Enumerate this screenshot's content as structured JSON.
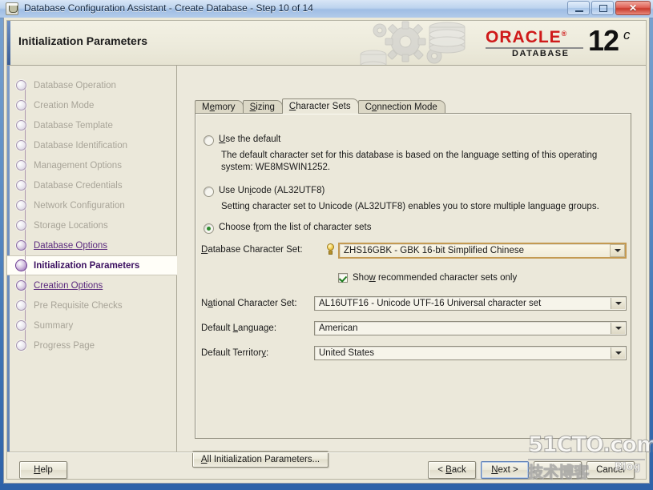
{
  "window": {
    "title": "Database Configuration Assistant - Create Database - Step 10 of 14",
    "app_icon": "java-cup-icon",
    "minimize": "minimize-icon",
    "maximize": "maximize-icon",
    "close": "close-icon"
  },
  "header": {
    "page_title": "Initialization Parameters",
    "brand": "ORACLE",
    "brand_reg": "®",
    "brand_sub": "DATABASE",
    "version_number": "12",
    "version_suffix": "c"
  },
  "sidebar": {
    "steps": [
      {
        "label": "Database Operation",
        "state": "pending"
      },
      {
        "label": "Creation Mode",
        "state": "pending"
      },
      {
        "label": "Database Template",
        "state": "pending"
      },
      {
        "label": "Database Identification",
        "state": "pending"
      },
      {
        "label": "Management Options",
        "state": "pending"
      },
      {
        "label": "Database Credentials",
        "state": "pending"
      },
      {
        "label": "Network Configuration",
        "state": "pending"
      },
      {
        "label": "Storage Locations",
        "state": "pending"
      },
      {
        "label": "Database Options",
        "state": "done"
      },
      {
        "label": "Initialization Parameters",
        "state": "current"
      },
      {
        "label": "Creation Options",
        "state": "done"
      },
      {
        "label": "Pre Requisite Checks",
        "state": "pending"
      },
      {
        "label": "Summary",
        "state": "pending"
      },
      {
        "label": "Progress Page",
        "state": "pending"
      }
    ]
  },
  "tabs": [
    {
      "label": "Memory",
      "mnemonic": "e",
      "active": false
    },
    {
      "label": "Sizing",
      "mnemonic": "S",
      "active": false
    },
    {
      "label": "Character Sets",
      "mnemonic": "C",
      "active": true
    },
    {
      "label": "Connection Mode",
      "mnemonic": "o",
      "active": false
    }
  ],
  "character_sets": {
    "option_default": {
      "label": "Use the default",
      "selected": false,
      "description": "The default character set for this database is based on the language setting of this operating system: WE8MSWIN1252."
    },
    "option_unicode": {
      "label": "Use Unicode (AL32UTF8)",
      "selected": false,
      "description": "Setting character set to Unicode (AL32UTF8) enables you to store multiple language groups."
    },
    "option_choose": {
      "label": "Choose from the list of character sets",
      "selected": true
    },
    "fields": {
      "database_character_set": {
        "label": "Database Character Set:",
        "value": "ZHS16GBK - GBK 16-bit Simplified Chinese",
        "hint_icon": "lightbulb-icon"
      },
      "show_recommended": {
        "label": "Show recommended character sets only",
        "checked": true
      },
      "national_character_set": {
        "label": "National Character Set:",
        "value": "AL16UTF16 - Unicode UTF-16 Universal character set"
      },
      "default_language": {
        "label": "Default Language:",
        "value": "American"
      },
      "default_territory": {
        "label": "Default Territory:",
        "value": "United States"
      }
    }
  },
  "actions": {
    "all_init_params": "All Initialization Parameters...",
    "help": "Help",
    "back": "< Back",
    "next": "Next >",
    "finish": "",
    "cancel": "Cancel"
  },
  "watermark": {
    "main": "51CTO.com",
    "cn": "技术博客",
    "blog": "Blog"
  }
}
